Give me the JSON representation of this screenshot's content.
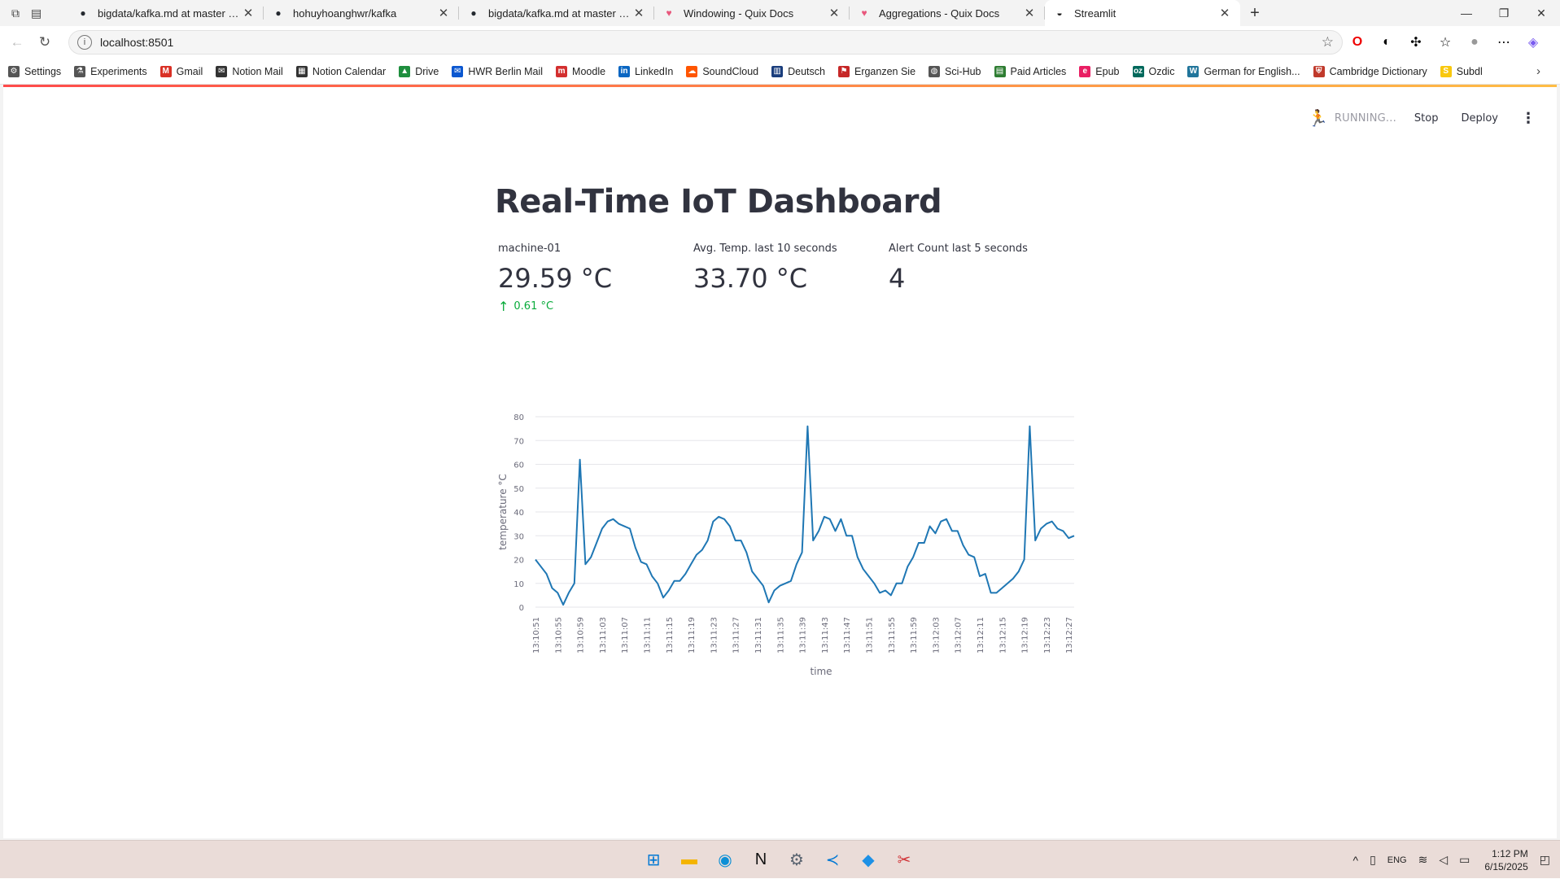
{
  "browser": {
    "tabs": [
      {
        "title": "bigdata/kafka.md at master · rola",
        "icon": "github-icon",
        "active": false
      },
      {
        "title": "hohuyhoanghwr/kafka",
        "icon": "github-icon",
        "active": false
      },
      {
        "title": "bigdata/kafka.md at master · rola",
        "icon": "github-icon",
        "active": false
      },
      {
        "title": "Windowing - Quix Docs",
        "icon": "quix-icon",
        "active": false
      },
      {
        "title": "Aggregations - Quix Docs",
        "icon": "quix-icon",
        "active": false
      },
      {
        "title": "Streamlit",
        "icon": "streamlit-icon",
        "active": true
      }
    ],
    "url": "localhost:8501",
    "bookmarks": [
      {
        "label": "Settings",
        "icon": "gear-icon",
        "color": "#555555"
      },
      {
        "label": "Experiments",
        "icon": "flask-icon",
        "color": "#555555"
      },
      {
        "label": "Gmail",
        "icon": "gmail-icon",
        "color": "#d93025"
      },
      {
        "label": "Notion Mail",
        "icon": "notion-mail-icon",
        "color": "#333333"
      },
      {
        "label": "Notion Calendar",
        "icon": "calendar-icon",
        "color": "#333333"
      },
      {
        "label": "Drive",
        "icon": "drive-icon",
        "color": "#1e8e3e"
      },
      {
        "label": "HWR Berlin Mail",
        "icon": "mail-icon",
        "color": "#0b57d0"
      },
      {
        "label": "Moodle",
        "icon": "moodle-icon",
        "color": "#d32f2f"
      },
      {
        "label": "LinkedIn",
        "icon": "linkedin-icon",
        "color": "#0a66c2"
      },
      {
        "label": "SoundCloud",
        "icon": "soundcloud-icon",
        "color": "#ff5500"
      },
      {
        "label": "Deutsch",
        "icon": "book-icon",
        "color": "#1a3d7c"
      },
      {
        "label": "Erganzen Sie",
        "icon": "flag-icon",
        "color": "#c62828"
      },
      {
        "label": "Sci-Hub",
        "icon": "globe-icon",
        "color": "#555555"
      },
      {
        "label": "Paid Articles",
        "icon": "document-icon",
        "color": "#2e7d32"
      },
      {
        "label": "Epub",
        "icon": "epub-icon",
        "color": "#e91e63"
      },
      {
        "label": "Ozdic",
        "icon": "ozdic-icon",
        "color": "#00695c"
      },
      {
        "label": "German for English...",
        "icon": "wordpress-icon",
        "color": "#21759b"
      },
      {
        "label": "Cambridge Dictionary",
        "icon": "cambridge-icon",
        "color": "#c0392b"
      },
      {
        "label": "Subdl",
        "icon": "subdl-icon",
        "color": "#f9c80e"
      }
    ]
  },
  "app": {
    "status": "RUNNING...",
    "stop_label": "Stop",
    "deploy_label": "Deploy",
    "title": "Real-Time IoT Dashboard",
    "metrics": [
      {
        "label": "machine-01",
        "value": "29.59 °C",
        "delta": "0.61 °C"
      },
      {
        "label": "Avg. Temp. last 10 seconds",
        "value": "33.70 °C",
        "delta": ""
      },
      {
        "label": "Alert Count last 5 seconds",
        "value": "4",
        "delta": ""
      }
    ]
  },
  "chart_data": {
    "type": "line",
    "xlabel": "time",
    "ylabel": "temperature °C",
    "ylim": [
      0,
      80
    ],
    "yticks": [
      0,
      10,
      20,
      30,
      40,
      50,
      60,
      70,
      80
    ],
    "color": "#1f77b4",
    "grid": true,
    "x_tick_labels": [
      "13:10:51",
      "13:10:55",
      "13:10:59",
      "13:11:03",
      "13:11:07",
      "13:11:11",
      "13:11:15",
      "13:11:19",
      "13:11:23",
      "13:11:27",
      "13:11:31",
      "13:11:35",
      "13:11:39",
      "13:11:43",
      "13:11:47",
      "13:11:51",
      "13:11:55",
      "13:11:59",
      "13:12:03",
      "13:12:07",
      "13:12:11",
      "13:12:15",
      "13:12:19",
      "13:12:23",
      "13:12:27"
    ],
    "x_start_seconds": 51,
    "x_step_seconds": 1,
    "values": [
      20,
      17,
      14,
      8,
      6,
      1,
      6,
      10,
      62,
      18,
      21,
      27,
      33,
      36,
      37,
      35,
      34,
      33,
      25,
      19,
      18,
      13,
      10,
      4,
      7,
      11,
      11,
      14,
      18,
      22,
      24,
      28,
      36,
      38,
      37,
      34,
      28,
      28,
      23,
      15,
      12,
      9,
      2,
      7,
      9,
      10,
      11,
      18,
      23,
      76,
      28,
      32,
      38,
      37,
      32,
      37,
      30,
      30,
      21,
      16,
      13,
      10,
      6,
      7,
      5,
      10,
      10,
      17,
      21,
      27,
      27,
      34,
      31,
      36,
      37,
      32,
      32,
      26,
      22,
      21,
      13,
      14,
      6,
      6,
      8,
      10,
      12,
      15,
      20,
      76,
      28,
      33,
      35,
      36,
      33,
      32,
      29,
      30
    ]
  },
  "taskbar": {
    "apps": [
      {
        "icon": "windows-start-icon",
        "glyph": "⊞",
        "color": "#0078d4"
      },
      {
        "icon": "file-explorer-icon",
        "glyph": "▬",
        "color": "#f4b400"
      },
      {
        "icon": "edge-icon",
        "glyph": "◉",
        "color": "#0c8fd6"
      },
      {
        "icon": "notion-icon",
        "glyph": "N",
        "color": "#111111"
      },
      {
        "icon": "settings-icon",
        "glyph": "⚙",
        "color": "#5a6470"
      },
      {
        "icon": "vscode-icon",
        "glyph": "≺",
        "color": "#0078d4"
      },
      {
        "icon": "docker-icon",
        "glyph": "◆",
        "color": "#1d91e6"
      },
      {
        "icon": "snipping-tool-icon",
        "glyph": "✂",
        "color": "#d13438"
      }
    ],
    "language": "ENG",
    "time": "1:12 PM",
    "date": "6/15/2025"
  }
}
